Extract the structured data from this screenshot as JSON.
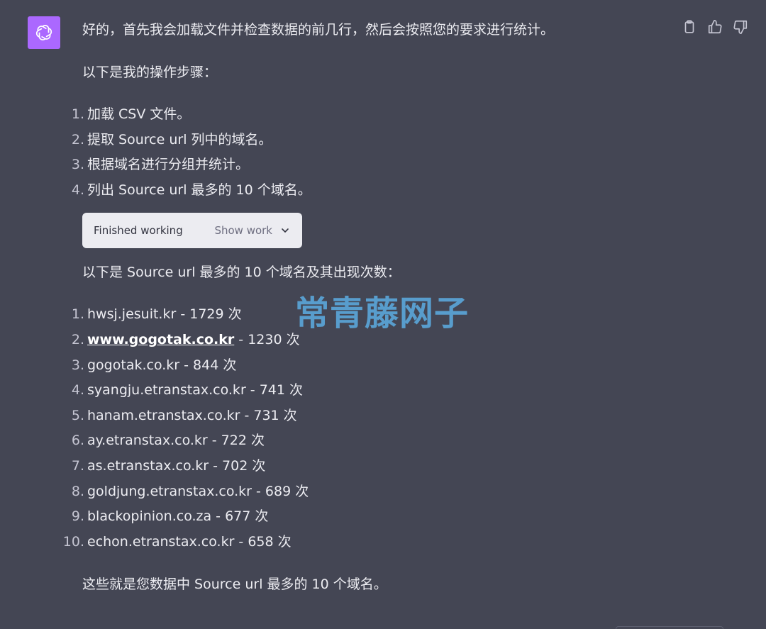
{
  "message": {
    "intro": "好的，首先我会加载文件并检查数据的前几行，然后会按照您的要求进行统计。",
    "steps_heading": "以下是我的操作步骤：",
    "steps": [
      {
        "num": "1.",
        "text": "加载 CSV 文件。"
      },
      {
        "num": "2.",
        "text": "提取 Source url 列中的域名。"
      },
      {
        "num": "3.",
        "text": "根据域名进行分组并统计。"
      },
      {
        "num": "4.",
        "text": "列出 Source url 最多的 10 个域名。"
      }
    ],
    "work_box": {
      "status": "Finished working",
      "toggle_label": "Show work"
    },
    "results_heading": "以下是 Source url 最多的 10 个域名及其出现次数：",
    "results": [
      {
        "num": "1.",
        "domain": "hwsj.jesuit.kr",
        "count": " - 1729 次"
      },
      {
        "num": "2.",
        "domain": "www.gogotak.co.kr",
        "count": " - 1230 次",
        "is_link": true
      },
      {
        "num": "3.",
        "domain": "gogotak.co.kr",
        "count": " - 844 次"
      },
      {
        "num": "4.",
        "domain": "syangju.etranstax.co.kr",
        "count": " - 741 次"
      },
      {
        "num": "5.",
        "domain": "hanam.etranstax.co.kr",
        "count": " - 731 次"
      },
      {
        "num": "6.",
        "domain": "ay.etranstax.co.kr",
        "count": " - 722 次"
      },
      {
        "num": "7.",
        "domain": "as.etranstax.co.kr",
        "count": " - 702 次"
      },
      {
        "num": "8.",
        "domain": "goldjung.etranstax.co.kr",
        "count": " - 689 次"
      },
      {
        "num": "9.",
        "domain": "blackopinion.co.za",
        "count": " - 677 次"
      },
      {
        "num": "10.",
        "domain": "echon.etranstax.co.kr",
        "count": " - 658 次"
      }
    ],
    "conclusion": "这些就是您数据中 Source url 最多的 10 个域名。"
  },
  "watermark": "常青藤网子",
  "icons": {
    "avatar": "openai-logo-icon",
    "copy": "clipboard-icon",
    "like": "thumbs-up-icon",
    "dislike": "thumbs-down-icon",
    "toggle": "chevron-down-icon"
  },
  "colors": {
    "background": "#444654",
    "avatar": "#ab68ff",
    "text": "#ececf1",
    "work_box": "#ececf1",
    "watermark": "#5aa2d4"
  }
}
